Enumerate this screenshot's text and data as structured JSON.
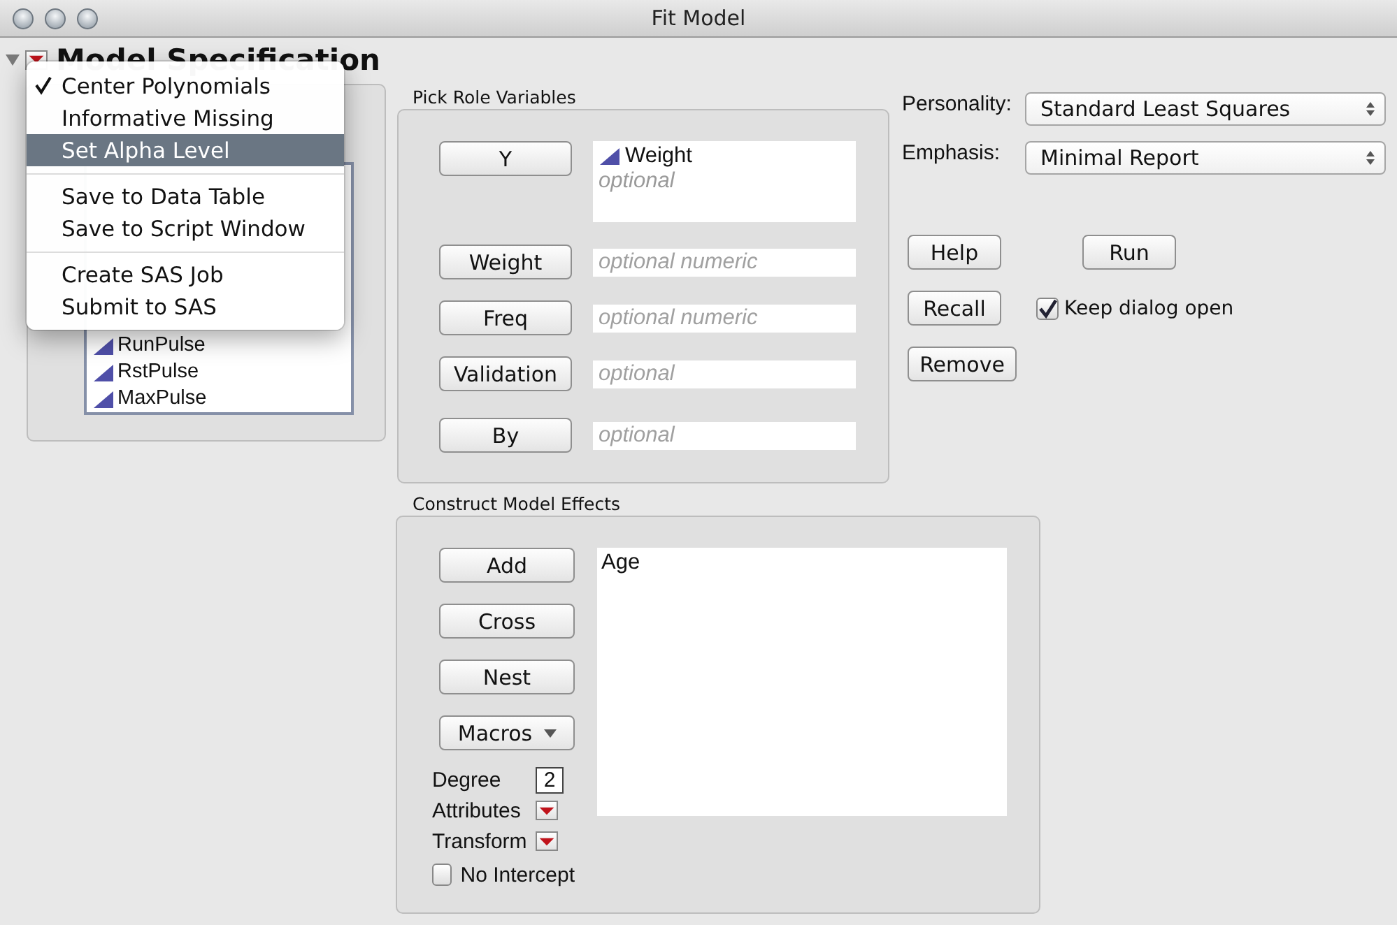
{
  "window": {
    "title": "Fit Model"
  },
  "header": {
    "title": "Model Specification",
    "expanded": true
  },
  "columns_list": {
    "items": [
      {
        "name": "RunPulse"
      },
      {
        "name": "RstPulse"
      },
      {
        "name": "MaxPulse"
      }
    ]
  },
  "context_menu": {
    "groups": [
      [
        {
          "label": "Center Polynomials",
          "checked": true,
          "selected": false
        },
        {
          "label": "Informative Missing",
          "checked": false,
          "selected": false
        },
        {
          "label": "Set Alpha Level",
          "checked": false,
          "selected": true
        }
      ],
      [
        {
          "label": "Save to Data Table",
          "checked": false,
          "selected": false
        },
        {
          "label": "Save to Script Window",
          "checked": false,
          "selected": false
        }
      ],
      [
        {
          "label": "Create SAS Job",
          "checked": false,
          "selected": false
        },
        {
          "label": "Submit to SAS",
          "checked": false,
          "selected": false
        }
      ]
    ]
  },
  "pick_roles": {
    "title": "Pick Role Variables",
    "roles": [
      {
        "button": "Y",
        "kind": "list",
        "values": [
          "Weight"
        ],
        "placeholder": "optional"
      },
      {
        "button": "Weight",
        "kind": "field",
        "placeholder": "optional numeric"
      },
      {
        "button": "Freq",
        "kind": "field",
        "placeholder": "optional numeric"
      },
      {
        "button": "Validation",
        "kind": "field",
        "placeholder": "optional"
      },
      {
        "button": "By",
        "kind": "field",
        "placeholder": "optional"
      }
    ]
  },
  "personality": {
    "label": "Personality:",
    "value": "Standard Least Squares"
  },
  "emphasis": {
    "label": "Emphasis:",
    "value": "Minimal Report"
  },
  "buttons": {
    "help": "Help",
    "run": "Run",
    "recall": "Recall",
    "remove": "Remove"
  },
  "keep_dialog_open": {
    "label": "Keep dialog open",
    "checked": true
  },
  "construct": {
    "title": "Construct Model Effects",
    "buttons": [
      {
        "label": "Add",
        "kind": "plain"
      },
      {
        "label": "Cross",
        "kind": "plain"
      },
      {
        "label": "Nest",
        "kind": "plain"
      },
      {
        "label": "Macros",
        "kind": "dropdown"
      }
    ],
    "effects": [
      "Age"
    ],
    "degree": {
      "label": "Degree",
      "value": "2"
    },
    "attributes": {
      "label": "Attributes"
    },
    "transform": {
      "label": "Transform"
    },
    "no_intercept": {
      "label": "No Intercept",
      "checked": false
    }
  }
}
